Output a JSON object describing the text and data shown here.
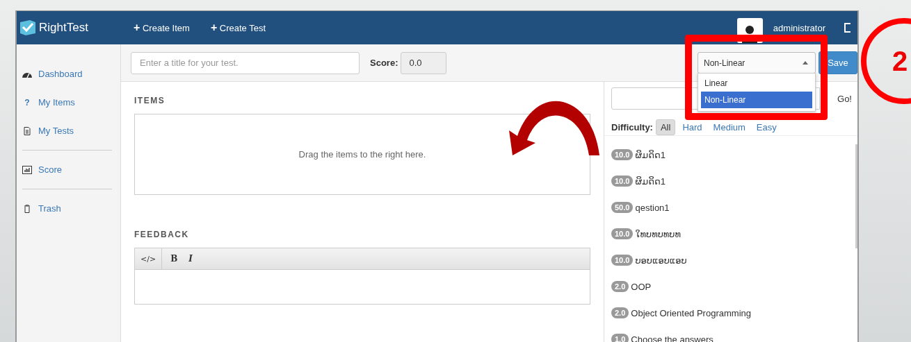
{
  "header": {
    "brand": "RightTest",
    "nav": [
      {
        "icon": "+",
        "label": "Create Item"
      },
      {
        "icon": "+",
        "label": "Create Test"
      }
    ],
    "user": "administrator"
  },
  "sidebar": {
    "groups": [
      [
        {
          "label": "Dashboard"
        },
        {
          "glyph": "?",
          "label": "My Items"
        },
        {
          "label": "My Tests"
        }
      ],
      [
        {
          "label": "Score"
        }
      ],
      [
        {
          "label": "Trash"
        }
      ]
    ]
  },
  "toolbar": {
    "title_placeholder": "Enter a title for your test.",
    "score_label": "Score:",
    "score": "0.0",
    "mode_select": {
      "value": "Non-Linear",
      "open": true,
      "options": [
        {
          "label": "Linear",
          "selected": false
        },
        {
          "label": "Non-Linear",
          "selected": true
        }
      ]
    },
    "save": "Save"
  },
  "items_panel": {
    "heading": "ITEMS",
    "drop_hint": "Drag the items to the right here."
  },
  "feedback": {
    "heading": "FEEDBACK",
    "tools": [
      {
        "kind": "code",
        "label": "</>"
      },
      {
        "kind": "bold",
        "label": "B"
      },
      {
        "kind": "italic",
        "label": "I"
      }
    ]
  },
  "library": {
    "go": "Go!",
    "difficulty_label": "Difficulty:",
    "filters": [
      {
        "label": "All",
        "selected": true
      },
      {
        "label": "Hard",
        "selected": false
      },
      {
        "label": "Medium",
        "selected": false
      },
      {
        "label": "Easy",
        "selected": false
      }
    ],
    "items": [
      {
        "score": "10.0",
        "title": "ຜິມດິດ1"
      },
      {
        "score": "10.0",
        "title": "ຜິມດິດ1"
      },
      {
        "score": "50.0",
        "title": "qestion1"
      },
      {
        "score": "10.0",
        "title": "ໃທບທບທບທ"
      },
      {
        "score": "10.0",
        "title": "ບອບແອບແອບ"
      },
      {
        "score": "2.0",
        "title": "OOP"
      },
      {
        "score": "2.0",
        "title": "Object Oriented Programming"
      },
      {
        "score": "1.0",
        "title": "Choose the answers"
      }
    ]
  },
  "annotation": {
    "step": "2"
  }
}
